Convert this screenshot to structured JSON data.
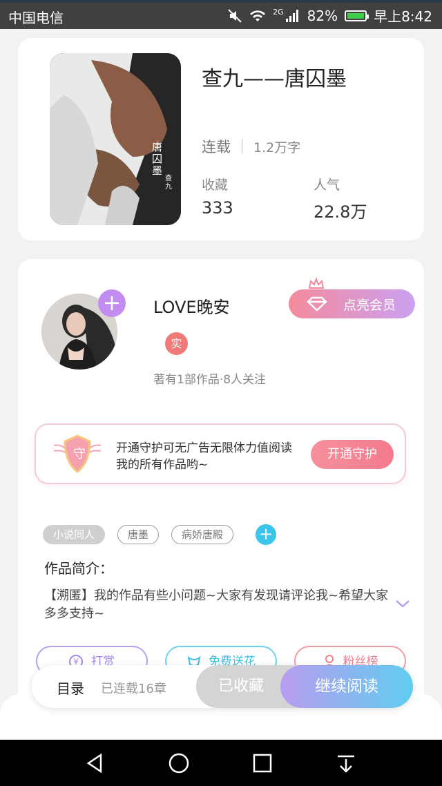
{
  "status_bar": {
    "carrier": "中国电信",
    "network": "2G",
    "battery_percent": "82%",
    "time": "早上8:42"
  },
  "book": {
    "title": "查九——唐囚墨",
    "status": "连载",
    "word_count": "1.2万字",
    "favorites_label": "收藏",
    "favorites_value": "333",
    "popularity_label": "人气",
    "popularity_value": "22.8万",
    "cover_text": "唐囚墨",
    "cover_author": "查九"
  },
  "author": {
    "name": "LOVE晚安",
    "verified_badge": "实",
    "meta": "著有1部作品·8人关注",
    "vip_button": "点亮会员"
  },
  "guard": {
    "shield_char": "守",
    "text": "开通守护可无广告无限体力值阅读我的所有作品哟~",
    "button": "开通守护"
  },
  "tags": [
    "小说同人",
    "唐墨",
    "病娇唐殿"
  ],
  "intro": {
    "label": "作品简介：",
    "text": "【溯匿】我的作品有些小问题~大家有发现请评论我~希望大家多多支持~"
  },
  "actions": {
    "reward": "打赏",
    "flower": "免费送花",
    "fans": "粉丝榜"
  },
  "bottom_bar": {
    "toc": "目录",
    "chapters": "已连载16章",
    "collected": "已收藏",
    "continue": "继续阅读"
  },
  "colors": {
    "accent_purple": "#c28cf0",
    "accent_blue": "#60cdf0",
    "accent_pink": "#f47a8c"
  }
}
